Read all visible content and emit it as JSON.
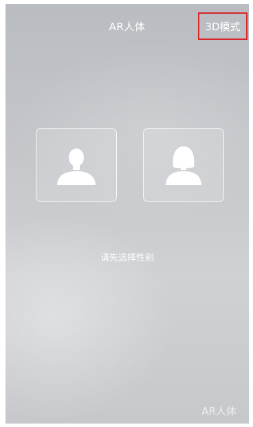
{
  "header": {
    "title": "AR人体",
    "mode_button_label": "3D模式"
  },
  "gender_options": [
    {
      "id": "male",
      "icon": "male-avatar-icon"
    },
    {
      "id": "female",
      "icon": "female-avatar-icon"
    }
  ],
  "prompt": "请先选择性别",
  "watermark": "AR人体",
  "colors": {
    "highlight_border": "#d9262a",
    "text": "#ffffff"
  }
}
